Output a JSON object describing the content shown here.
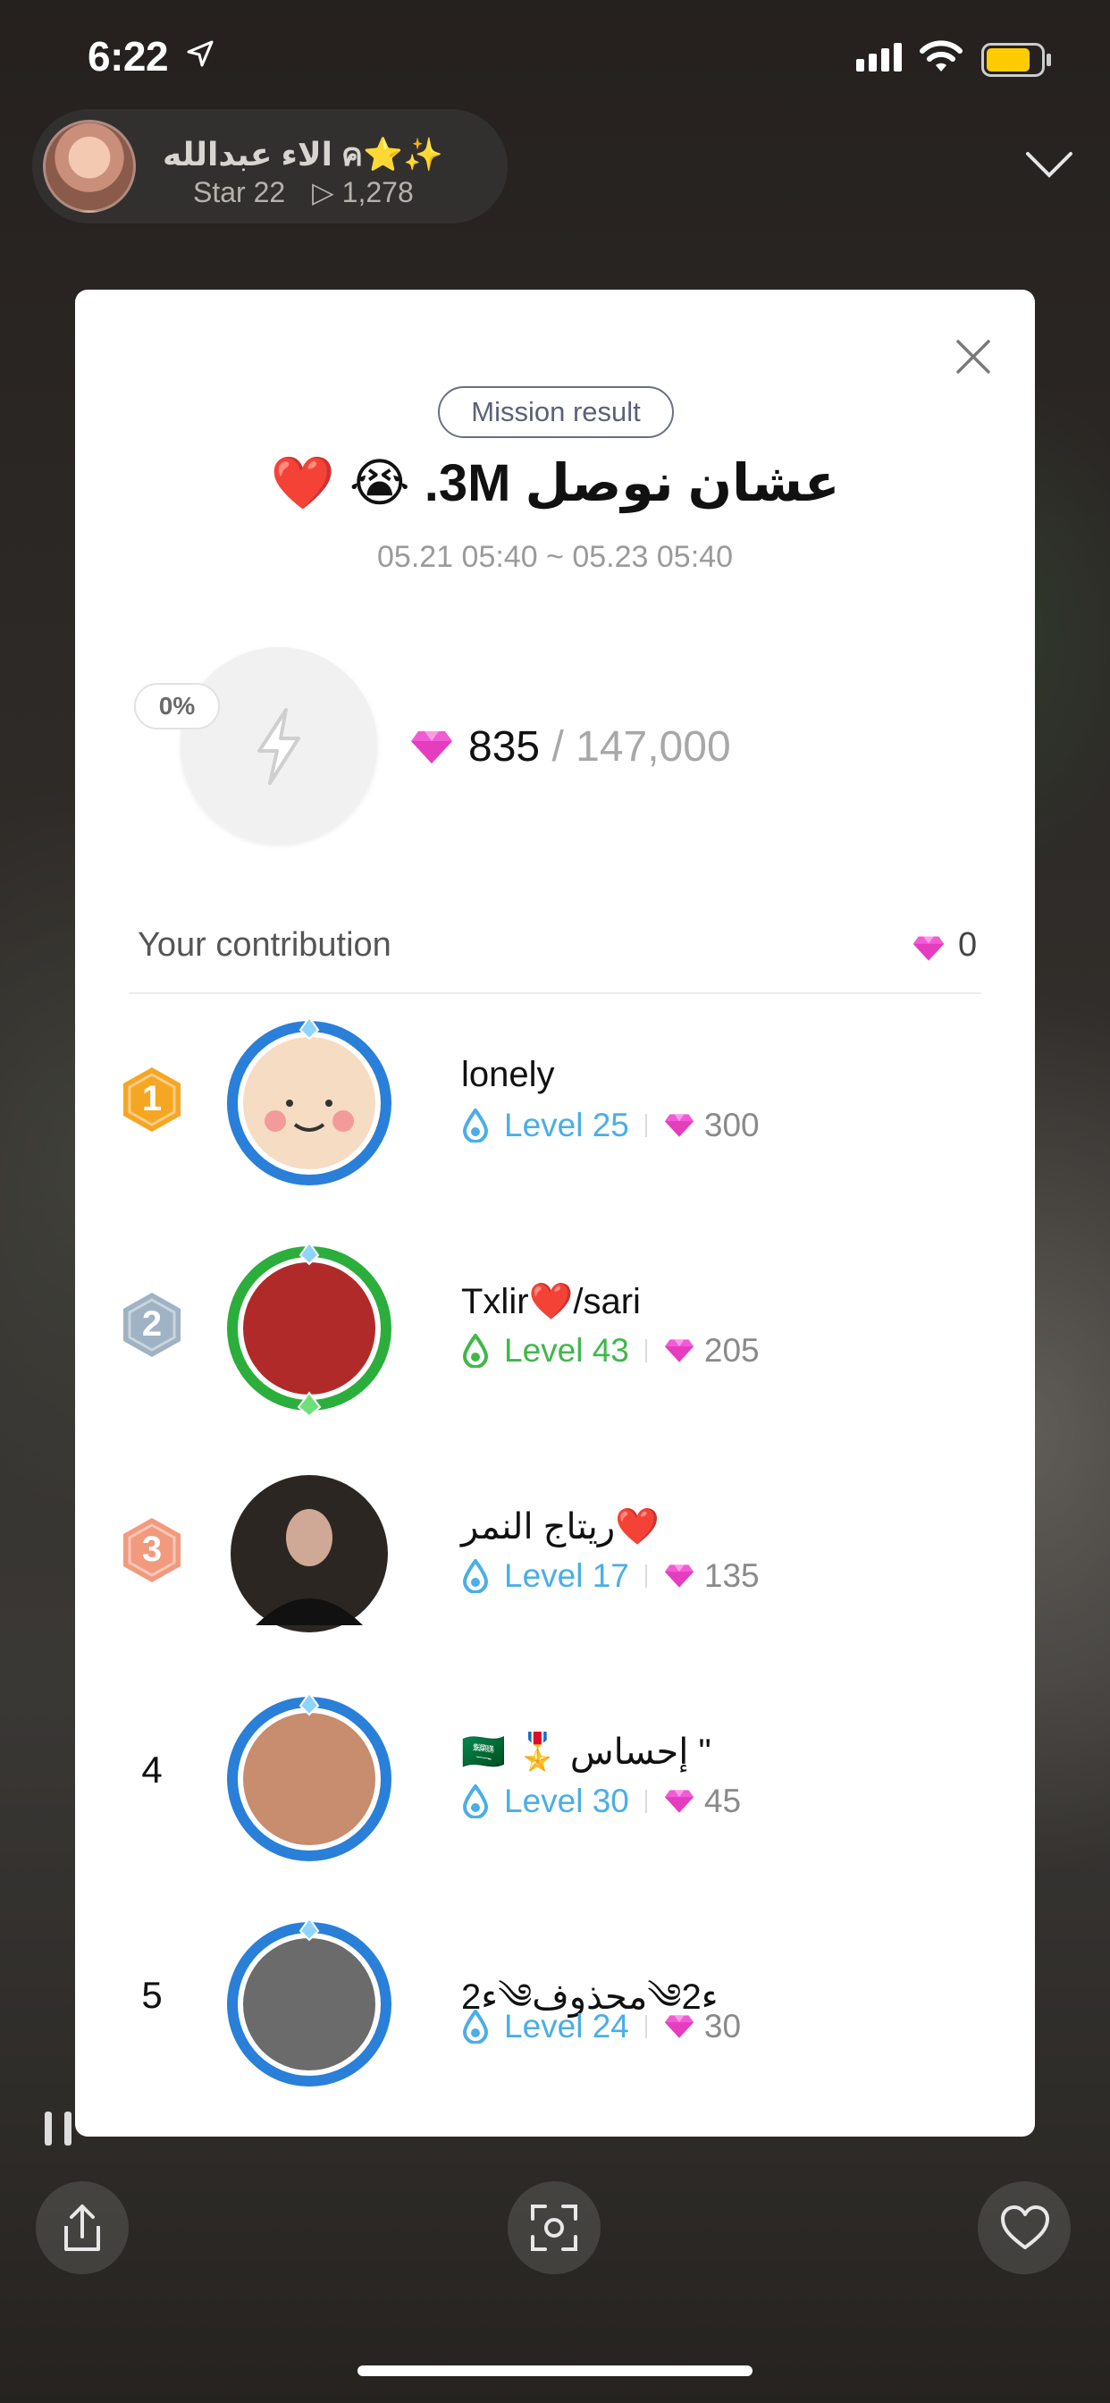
{
  "status_bar": {
    "time": "6:22"
  },
  "host": {
    "name": "الاء عبدالله ค⭐✨",
    "star": "Star 22",
    "views": "▷ 1,278"
  },
  "modal": {
    "badge": "Mission result",
    "title": "عشان نوصل 3M. 😭 ❤️",
    "date_range": "05.21 05:40 ~ 05.23 05:40",
    "progress_percent": "0%",
    "progress_fraction": 0.0057,
    "current": "835",
    "separator": "/",
    "goal": "147,000",
    "contribution_label": "Your contribution",
    "contribution_value": "0",
    "ranking": [
      {
        "rank": "1",
        "name": "lonely",
        "level": "Level 25",
        "gifts": "300",
        "level_color": "#4aaee8",
        "badge_color": "#f5a623"
      },
      {
        "rank": "2",
        "name": "Txlir❤️/sari",
        "level": "Level 43",
        "gifts": "205",
        "level_color": "#3fb84a",
        "badge_color": "#9fb3c4"
      },
      {
        "rank": "3",
        "name": "ريتاج النمر❤️",
        "level": "Level 17",
        "gifts": "135",
        "level_color": "#4aaee8",
        "badge_color": "#f29a7e"
      },
      {
        "rank": "4",
        "name": "🇸🇦 🎖️ إحساس \"",
        "level": "Level 30",
        "gifts": "45",
        "level_color": "#4aaee8"
      },
      {
        "rank": "5",
        "name": "2ء༄محذوف༄ء2",
        "level": "Level 24",
        "gifts": "30",
        "level_color": "#4aaee8"
      }
    ]
  },
  "icons": [
    "location-arrow-icon",
    "signal-icon",
    "wifi-icon",
    "battery-icon",
    "chevron-down-icon",
    "close-icon",
    "lightning-icon",
    "diamond-icon",
    "level-drop-icon",
    "rank-medal-icon",
    "share-icon",
    "screenshot-icon",
    "heart-icon",
    "pause-icon"
  ]
}
